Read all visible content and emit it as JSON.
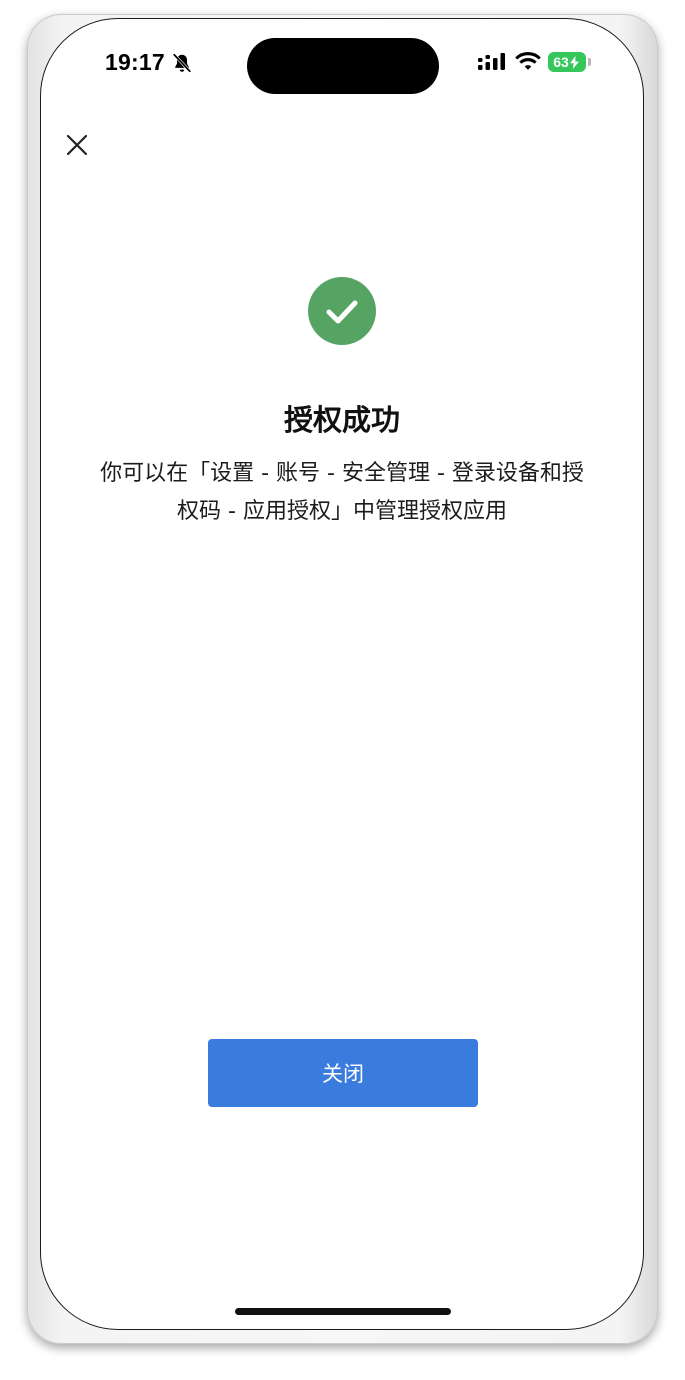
{
  "status_bar": {
    "time": "19:17",
    "battery_level": "63",
    "icons": {
      "silent": "bell-slash-icon",
      "signal": "cellular-signal-icon",
      "wifi": "wifi-icon",
      "battery": "battery-charging-icon"
    },
    "battery_color": "#35c759"
  },
  "header": {
    "close_icon": "close-icon"
  },
  "result": {
    "icon": "check-circle-icon",
    "icon_color": "#56a463",
    "title": "授权成功",
    "description": "你可以在「设置 - 账号 - 安全管理 - 登录设备和授权码 - 应用授权」中管理授权应用"
  },
  "actions": {
    "close_label": "关闭",
    "close_color": "#3a7bde"
  }
}
